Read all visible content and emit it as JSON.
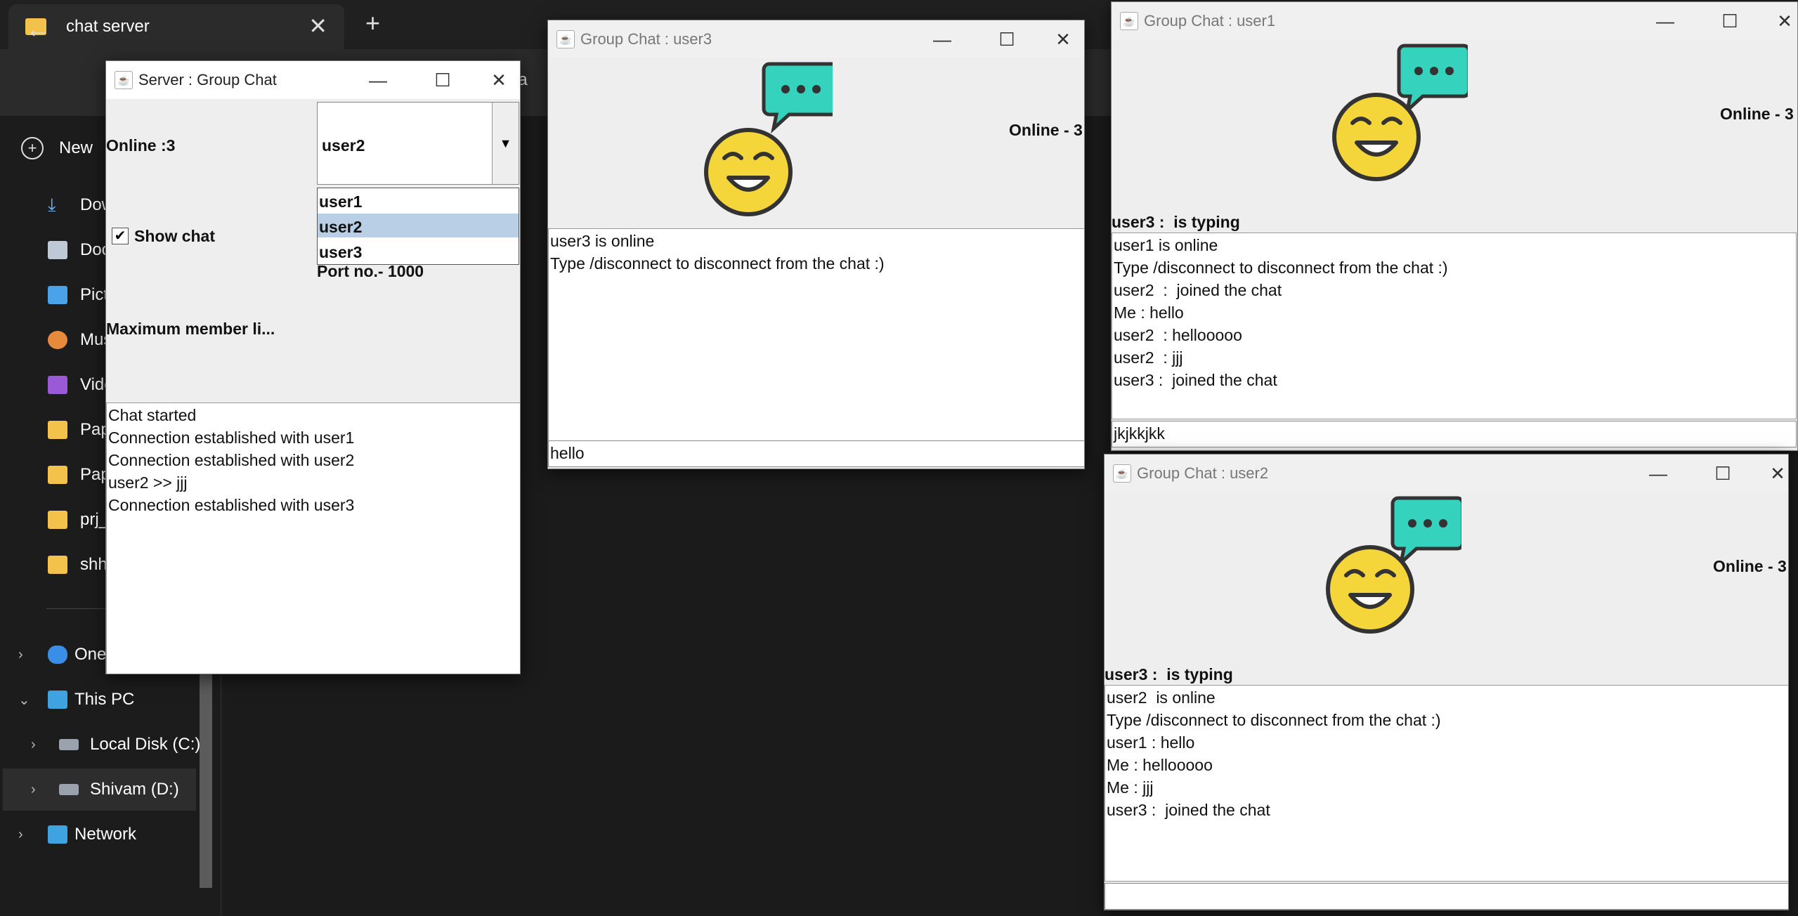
{
  "explorer": {
    "tab_title": "chat server",
    "new_label": "New",
    "address_fragment": "iva",
    "side_items": [
      "Dow",
      "Docu",
      "Pictu",
      "Musi",
      "Vide",
      "Pape",
      "Pape",
      "prj_i",
      "shh"
    ],
    "onedrive": "One",
    "this_pc": "This PC",
    "local_disk": "Local Disk (C:)",
    "shivam": "Shivam (D:)",
    "network": "Network"
  },
  "server": {
    "title": "Server : Group Chat",
    "online": "Online :3",
    "selected": "user2",
    "options": [
      "user1",
      "user2",
      "user3"
    ],
    "show_chat": "Show chat",
    "show_chat_checked": true,
    "port": "Port no.- 1000",
    "max_members": "Maximum member li...",
    "log": [
      "Chat started",
      "Connection established with user1",
      "Connection established with user2",
      "user2 >> jjj",
      "Connection established with user3"
    ]
  },
  "user3": {
    "title": "Group Chat : user3",
    "online": "Online - 3",
    "status": "",
    "messages": [
      "user3 is online",
      "Type /disconnect to disconnect from the chat :)"
    ],
    "input": "hello"
  },
  "user1": {
    "title": "Group Chat : user1",
    "online": "Online - 3",
    "status": "user3 :  is typing",
    "messages": [
      "user1 is online",
      "Type /disconnect to disconnect from the chat :)",
      "user2  :  joined the chat",
      "Me : hello",
      "user2  : hellooooo",
      "user2  : jjj",
      "user3 :  joined the chat"
    ],
    "input": "jkjkkjkk"
  },
  "user2": {
    "title": "Group Chat : user2",
    "online": "Online - 3",
    "status": "user3 :  is typing",
    "messages": [
      "user2  is online",
      "Type /disconnect to disconnect from the chat :)",
      "user1 : hello",
      "Me : hellooooo",
      "Me : jjj",
      "user3 :  joined the chat"
    ],
    "input": ""
  },
  "colors": {
    "emoji_face": "#f5d63a",
    "bubble": "#35d3bd",
    "outline": "#333333"
  }
}
